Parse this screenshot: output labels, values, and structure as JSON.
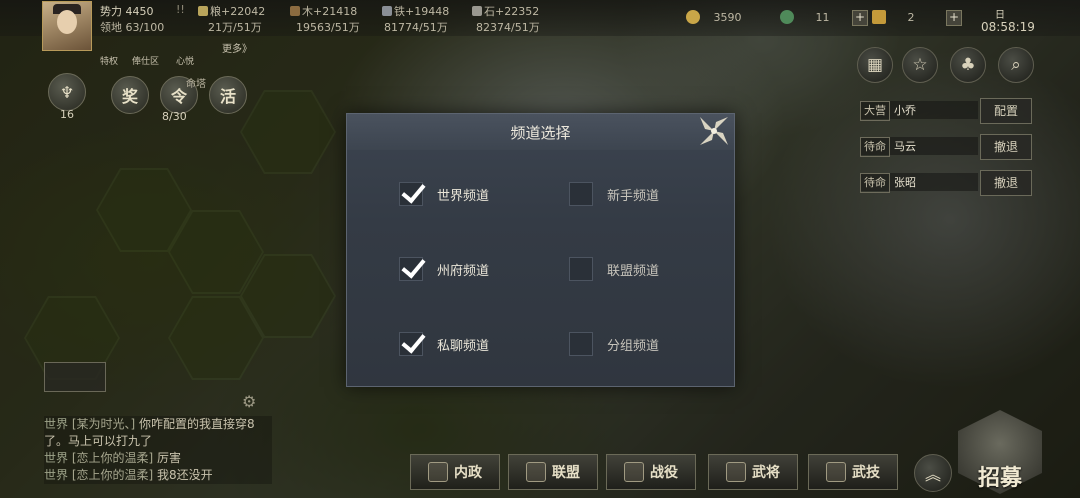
{
  "player": {
    "power_label": "势力 4450",
    "territory_label": "领地 63/100",
    "flag_label": "!!"
  },
  "resources": {
    "grain": "粮+22042",
    "grain_cap": "21万/51万",
    "wood": "木+21418",
    "wood_cap": "19563/51万",
    "iron": "铁+19448",
    "iron_cap": "81774/51万",
    "stone": "石+22352",
    "stone_cap": "82374/51万"
  },
  "sub_links": {
    "privilege": "特权",
    "settlement": "俸仕区",
    "mood": "心悦",
    "more": "更多》"
  },
  "currency": {
    "copper": "3590",
    "gem": "11",
    "gold": "2"
  },
  "clock": {
    "period": "日",
    "time": "08:58:19"
  },
  "left_tools": {
    "troop_count": "16",
    "reward": "奖",
    "order": "令",
    "activity": "活",
    "order_count": "8/30",
    "order_hint": "命塔"
  },
  "troops": [
    {
      "tag": "大营",
      "name": "小乔",
      "action": "配置"
    },
    {
      "tag": "待命",
      "name": "马云",
      "action": "撤退"
    },
    {
      "tag": "待命",
      "name": "张昭",
      "action": "撤退"
    }
  ],
  "dialog": {
    "title": "频道选择",
    "options": [
      {
        "label": "世界频道",
        "checked": true
      },
      {
        "label": "新手频道",
        "checked": false
      },
      {
        "label": "州府频道",
        "checked": true
      },
      {
        "label": "联盟频道",
        "checked": false
      },
      {
        "label": "私聊频道",
        "checked": true
      },
      {
        "label": "分组频道",
        "checked": false
      }
    ]
  },
  "chat": [
    {
      "channel": "世界",
      "who": "[某为时光、]",
      "text": "你咋配置的我直接穿8了。马上可以打九了"
    },
    {
      "channel": "世界",
      "who": "[恋上你的温柔]",
      "text": "厉害"
    },
    {
      "channel": "世界",
      "who": "[恋上你的温柔]",
      "text": "我8还没开"
    }
  ],
  "bottom_nav": {
    "domestic": "内政",
    "alliance": "联盟",
    "battle": "战役",
    "general": "武将",
    "skill": "武技",
    "recruit": "招募"
  }
}
